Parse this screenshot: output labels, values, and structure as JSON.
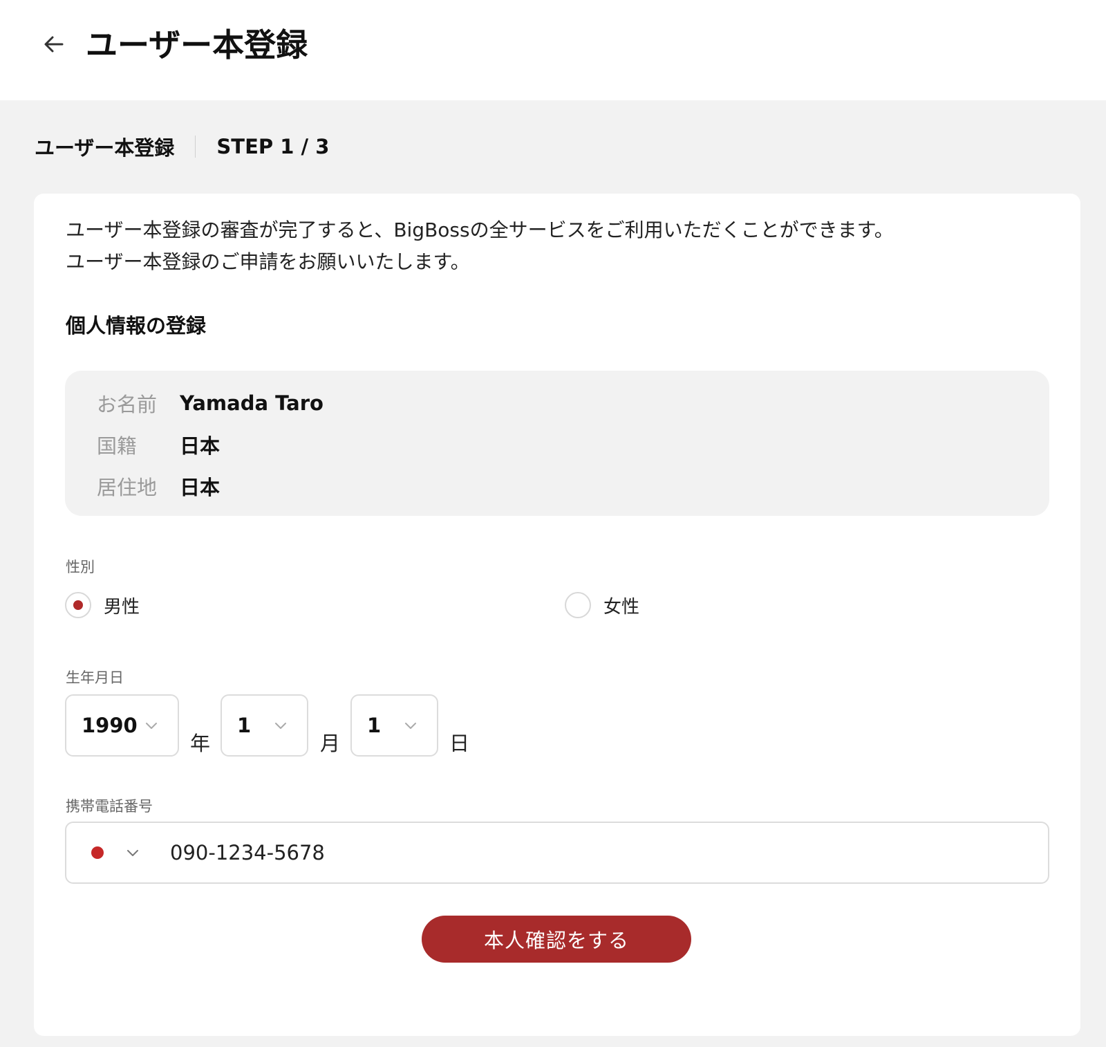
{
  "header": {
    "title": "ユーザー本登録",
    "back_icon": "arrow-left-icon"
  },
  "step": {
    "label": "ユーザー本登録",
    "count": "STEP 1 / 3"
  },
  "intro": {
    "line1": "ユーザー本登録の審査が完了すると、BigBossの全サービスをご利用いただくことができます。",
    "line2": "ユーザー本登録のご申請をお願いいたします。"
  },
  "section": {
    "title": "個人情報の登録"
  },
  "info": {
    "name_label": "お名前",
    "name_value": "Yamada Taro",
    "nationality_label": "国籍",
    "nationality_value": "日本",
    "residence_label": "居住地",
    "residence_value": "日本"
  },
  "gender": {
    "label": "性別",
    "options": [
      {
        "label": "男性",
        "selected": true
      },
      {
        "label": "女性",
        "selected": false
      }
    ]
  },
  "dob": {
    "label": "生年月日",
    "year": "1990",
    "year_unit": "年",
    "month": "1",
    "month_unit": "月",
    "day": "1",
    "day_unit": "日"
  },
  "phone": {
    "label": "携帯電話番号",
    "value": "090-1234-5678",
    "flag_color": "#c62828"
  },
  "submit": {
    "label": "本人確認をする"
  },
  "colors": {
    "accent": "#a82b2b",
    "background": "#f2f2f2"
  }
}
